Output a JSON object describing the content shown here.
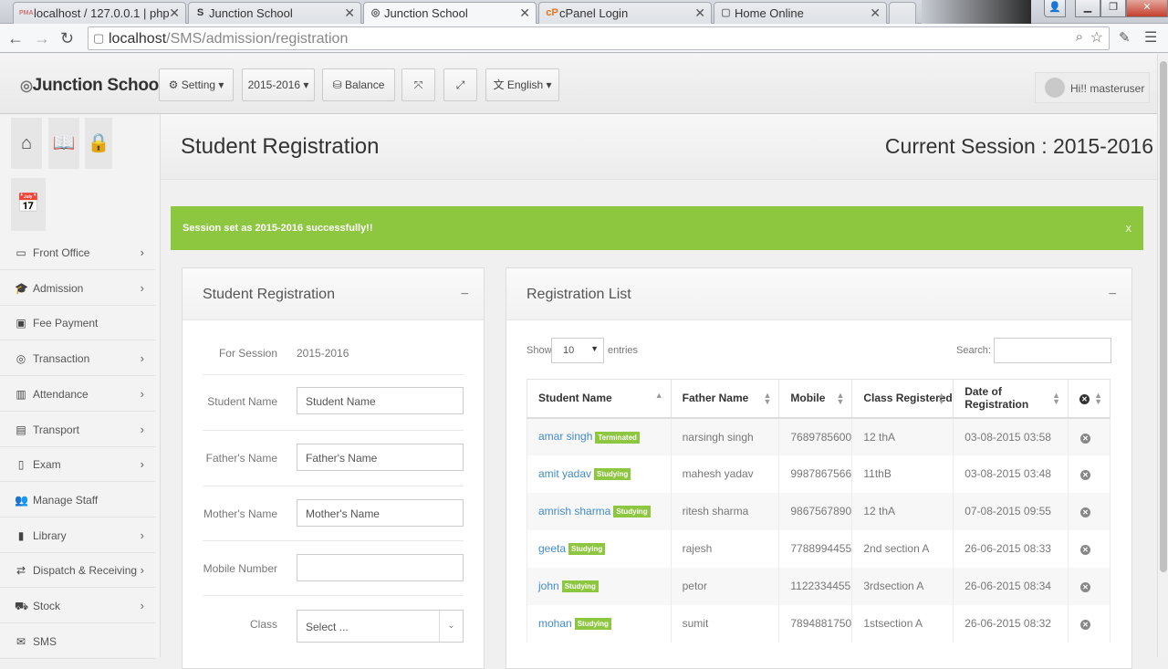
{
  "browser": {
    "tabs": [
      {
        "title": "localhost / 127.0.0.1 | php",
        "favicon": "PMA"
      },
      {
        "title": "Junction School",
        "favicon": "S"
      },
      {
        "title": "Junction School",
        "favicon": "◎"
      },
      {
        "title": "cPanel Login",
        "favicon": "cP"
      },
      {
        "title": "Home Online",
        "favicon": "▢"
      }
    ],
    "url_host": "localhost",
    "url_path": "/SMS/admission/registration"
  },
  "header": {
    "brand": "Junction School",
    "setting_label": "Setting",
    "session_label": "2015-2016",
    "balance_label": "Balance",
    "language_label": "English",
    "user_label": "Hi!! masteruser"
  },
  "sidebar": {
    "menu": [
      {
        "label": "Front Office",
        "icon": "monitor-icon",
        "glyph": "▭",
        "arrow": true
      },
      {
        "label": "Admission",
        "icon": "graduation-cap-icon",
        "glyph": "🎓",
        "arrow": true
      },
      {
        "label": "Fee Payment",
        "icon": "money-icon",
        "glyph": "▣",
        "arrow": false
      },
      {
        "label": "Transaction",
        "icon": "coin-icon",
        "glyph": "◎",
        "arrow": true
      },
      {
        "label": "Attendance",
        "icon": "bar-chart-icon",
        "glyph": "▥",
        "arrow": true
      },
      {
        "label": "Transport",
        "icon": "bus-icon",
        "glyph": "▤",
        "arrow": true
      },
      {
        "label": "Exam",
        "icon": "file-icon",
        "glyph": "▯",
        "arrow": true
      },
      {
        "label": "Manage Staff",
        "icon": "users-icon",
        "glyph": "👥",
        "arrow": false
      },
      {
        "label": "Library",
        "icon": "book-icon",
        "glyph": "▮",
        "arrow": true
      },
      {
        "label": "Dispatch & Receiving",
        "icon": "exchange-icon",
        "glyph": "⇄",
        "arrow": true
      },
      {
        "label": "Stock",
        "icon": "cart-icon",
        "glyph": "⛟",
        "arrow": true
      },
      {
        "label": "SMS",
        "icon": "envelope-icon",
        "glyph": "✉",
        "arrow": false
      }
    ]
  },
  "page": {
    "title": "Student Registration",
    "current_session": "Current Session : 2015-2016",
    "alert": "Session set as 2015-2016 successfully!!",
    "alert_close": "x"
  },
  "form": {
    "title": "Student Registration",
    "collapse": "−",
    "session_label": "For Session",
    "session_value": "2015-2016",
    "student_name_label": "Student Name",
    "student_name_placeholder": "Student Name",
    "father_name_label": "Father's Name",
    "father_name_placeholder": "Father's Name",
    "mother_name_label": "Mother's Name",
    "mother_name_placeholder": "Mother's Name",
    "mobile_label": "Mobile Number",
    "mobile_value": "",
    "class_label": "Class",
    "class_value": "Select ..."
  },
  "list": {
    "title": "Registration List",
    "collapse": "−",
    "show_label": "Show",
    "page_size": "10",
    "entries_label": "entries",
    "search_label": "Search:",
    "search_value": "",
    "columns": [
      "Student Name",
      "Father Name",
      "Mobile",
      "Class Registered",
      "Date of Registration"
    ],
    "rows": [
      {
        "name": "amar singh",
        "status": "Terminated",
        "father": "narsingh singh",
        "mobile": "7689785600",
        "class": "12 thA",
        "date": "03-08-2015 03:58"
      },
      {
        "name": "amit yadav",
        "status": "Studying",
        "father": "mahesh yadav",
        "mobile": "9987867566",
        "class": "11thB",
        "date": "03-08-2015 03:48"
      },
      {
        "name": "amrish sharma",
        "status": "Studying",
        "father": "ritesh sharma",
        "mobile": "9867567890",
        "class": "12 thA",
        "date": "07-08-2015 09:55"
      },
      {
        "name": "geeta",
        "status": "Studying",
        "father": "rajesh",
        "mobile": "7788994455",
        "class": "2nd section A",
        "date": "26-06-2015 08:33"
      },
      {
        "name": "john",
        "status": "Studying",
        "father": "petor",
        "mobile": "1122334455",
        "class": "3rdsection A",
        "date": "26-06-2015 08:34"
      },
      {
        "name": "mohan",
        "status": "Studying",
        "father": "sumit",
        "mobile": "7894881750",
        "class": "1stsection A",
        "date": "26-06-2015 08:32"
      }
    ]
  }
}
